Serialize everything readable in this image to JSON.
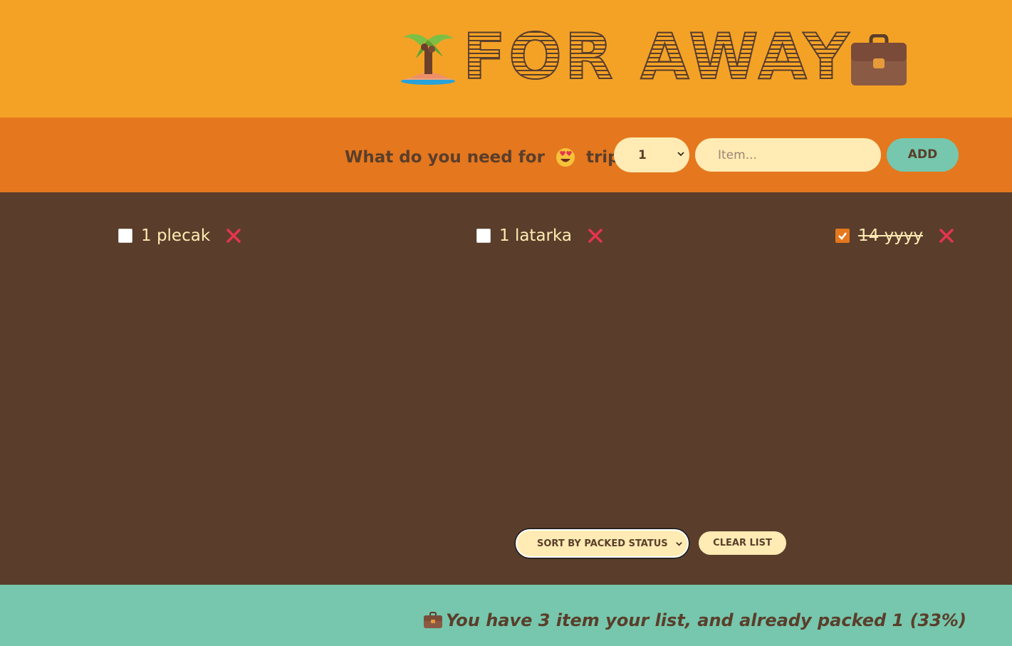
{
  "header": {
    "title": "FOR AWAY",
    "left_icon": "palm-island-icon",
    "right_icon": "briefcase-icon"
  },
  "form": {
    "question_before": "What do you need for",
    "question_emoji": "heart-eyes-emoji",
    "question_after": "trip?",
    "quantity_value": "1",
    "item_placeholder": "Item...",
    "add_label": "ADD"
  },
  "items": [
    {
      "quantity": 1,
      "label": "1 plecak",
      "packed": false
    },
    {
      "quantity": 1,
      "label": "1 latarka",
      "packed": false
    },
    {
      "quantity": 14,
      "label": "14 yyyy",
      "packed": true
    }
  ],
  "actions": {
    "sort_value": "SORT BY PACKED STATUS",
    "clear_label": "CLEAR LIST"
  },
  "stats": {
    "icon": "briefcase-icon",
    "text": "You have 3 item your list, and already packed 1 (33%)"
  },
  "colors": {
    "header_bg": "#f4a226",
    "form_bg": "#e5771e",
    "list_bg": "#5a3e2b",
    "stats_bg": "#76c7ad",
    "cream": "#ffebb3",
    "delete": "#e5344f"
  }
}
